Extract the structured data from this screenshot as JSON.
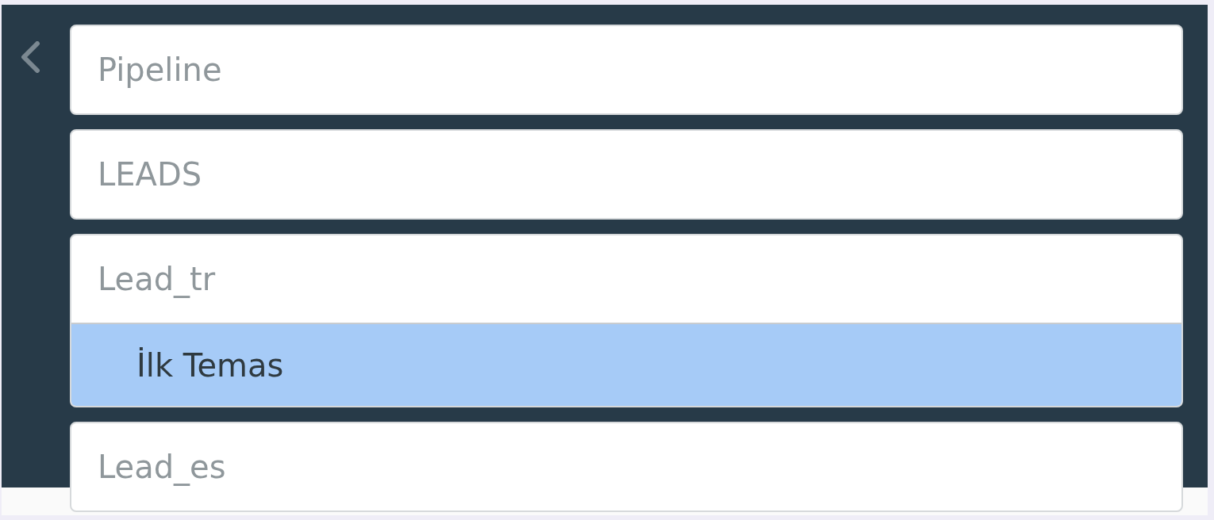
{
  "groups": [
    {
      "label": "Pipeline"
    },
    {
      "label": "LEADS"
    },
    {
      "label": "Lead_tr",
      "children": [
        {
          "label": "İlk Temas",
          "selected": true
        }
      ]
    },
    {
      "label": "Lead_es"
    }
  ]
}
